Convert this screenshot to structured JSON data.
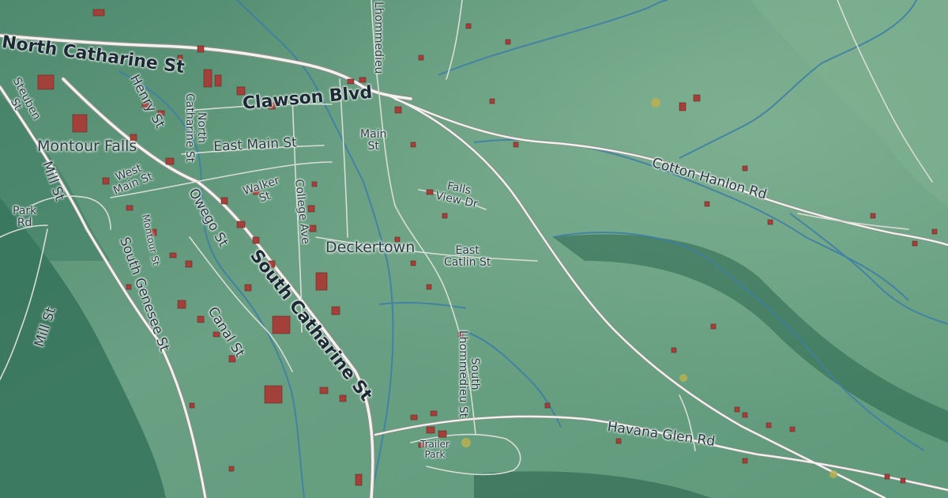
{
  "map": {
    "colors": {
      "terrain": "#5a9677",
      "terrain_dark": "#2f6e57",
      "stream": "#3f7fa6",
      "road_casing": "#8a8f88",
      "road_fill": "#f2f2ee",
      "building": "#a3403a"
    },
    "places": {
      "montour_falls": "Montour Falls",
      "deckertown": "Deckertown"
    },
    "roads": {
      "north_catharine": "North Catharine St",
      "clawson": "Clawson Blvd",
      "east_main": "East Main St",
      "south_catharine": "South Catharine St",
      "cotton_hanlon": "Cotton Hanlon Rd",
      "havana_glen": "Havana Glen Rd",
      "lhommedieu_top": "Lhommedieu",
      "main_st": "Main\nSt",
      "henry": "Henry St",
      "north_catharine_side": "North\nCatharine St",
      "steuben": "Steuben\nSt",
      "mill_top": "Mill St",
      "mill_bottom": "Mill St",
      "park_rd": "Park\nRd",
      "west_main": "West\nMain St",
      "montour_st": "Montour St",
      "south_genesee": "South Genesee St",
      "owego": "Owego St",
      "walker": "Walker\nSt",
      "college": "College Ave",
      "falls_view": "Falls\nView Dr",
      "east_catlin": "East\nCatlin St",
      "canal": "Canal St",
      "south_lhommedieu": "South\nLhommedieu St",
      "trailer_park": "Trailer\nPark"
    }
  }
}
